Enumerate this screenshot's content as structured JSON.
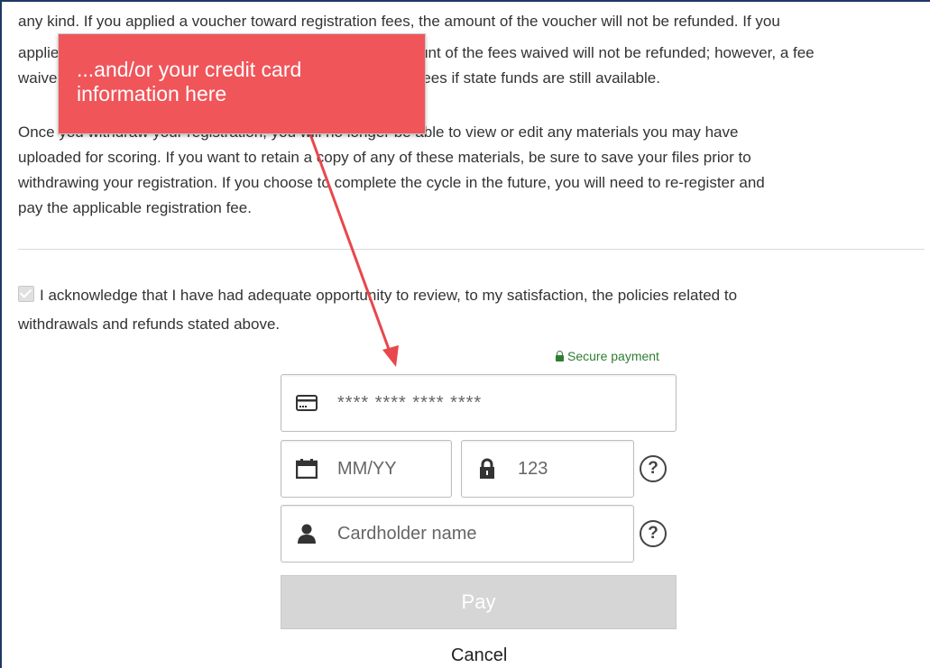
{
  "policy": {
    "line_top_fragment": "any kind. If you applied a voucher toward registration fees, the amount of the voucher will not be refunded. If you",
    "line_2": "applied a state fee waiver toward registration fees, the amount of the fees waived will not be refunded; however, a fee",
    "line_3": "waiver may be applied to a subsequent cycle's registration fees if state funds are still available.",
    "para2_line1": "Once you withdraw your registration, you will no longer be able to view or edit any materials you may have",
    "para2_line2": "uploaded for scoring. If you want to retain a copy of any of these materials, be sure to save your files prior to",
    "para2_line3": "withdrawing your registration. If you choose to complete the cycle in the future, you will need to re-register and",
    "para2_line4": "pay the applicable registration fee."
  },
  "acknowledgement": {
    "line1": "I acknowledge that I have had adequate opportunity to review, to my satisfaction, the policies related to",
    "line2": "withdrawals and refunds stated above.",
    "checked": true
  },
  "payment": {
    "secure_label": "Secure payment",
    "card_number_placeholder": "**** **** **** ****",
    "expiry_placeholder": "MM/YY",
    "cvc_placeholder": "123",
    "cardholder_placeholder": "Cardholder name",
    "help_glyph": "?",
    "pay_label": "Pay",
    "cancel_label": "Cancel"
  },
  "annotation": {
    "callout_line1": "...and/or your credit card",
    "callout_line2": "information here",
    "color": "#f0555a"
  },
  "icons": {
    "card": "credit-card-icon",
    "calendar": "calendar-icon",
    "lock": "lock-icon",
    "user": "user-icon"
  }
}
